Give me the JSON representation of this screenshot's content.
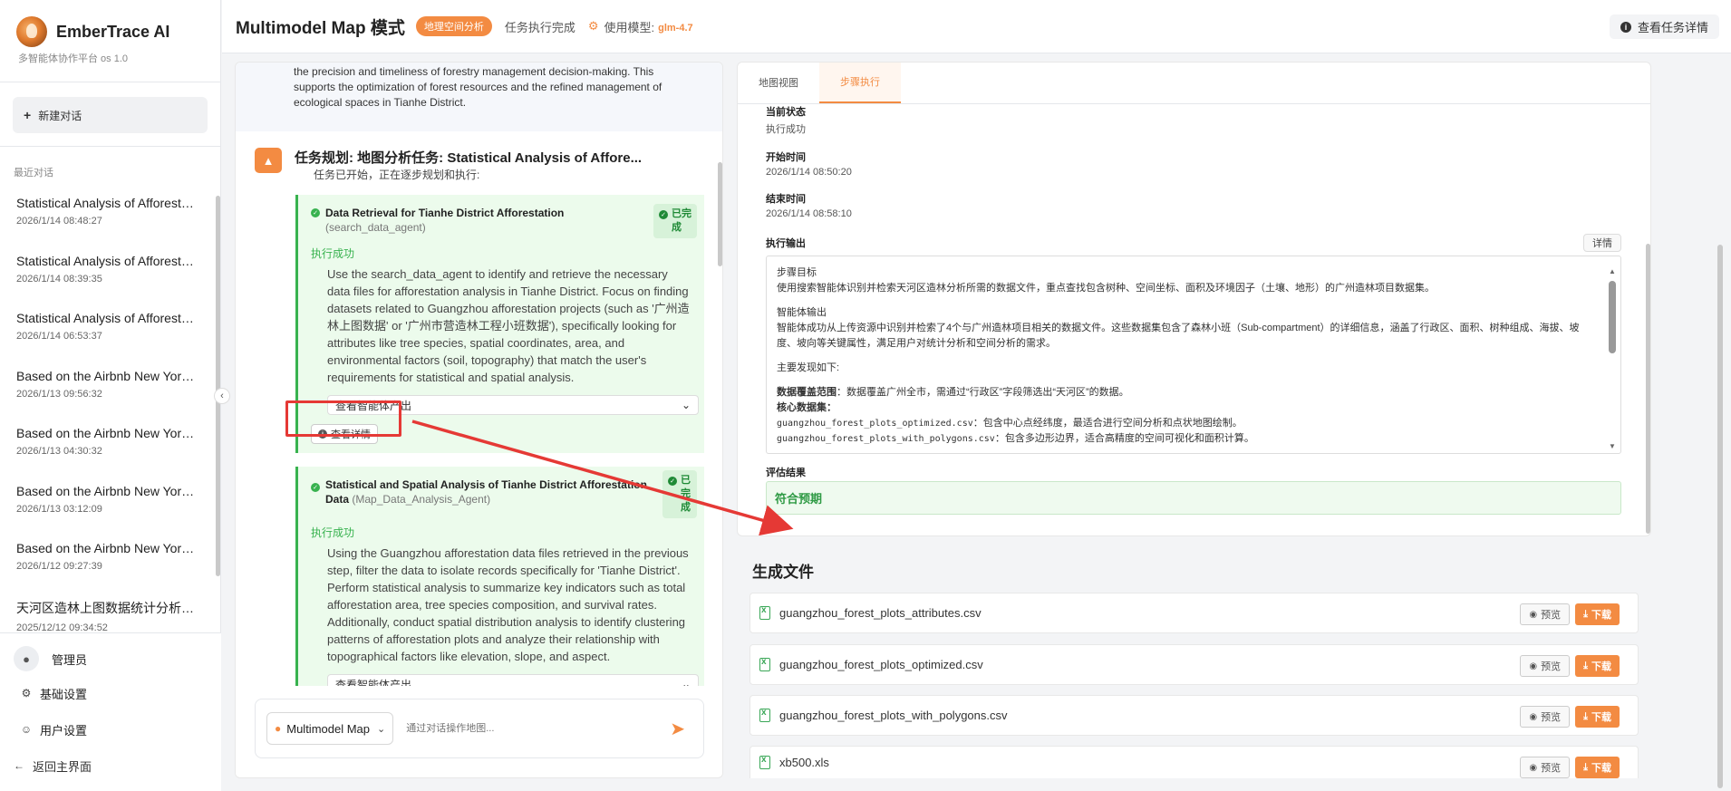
{
  "sidebar": {
    "brand_title": "EmberTrace AI",
    "brand_subtitle": "多智能体协作平台 os 1.0",
    "new_chat_label": "新建对话",
    "recent_label": "最近对话",
    "history": [
      {
        "title": "Statistical Analysis of Afforestation…",
        "date": "2026/1/14 08:48:27"
      },
      {
        "title": "Statistical Analysis of Afforestation…",
        "date": "2026/1/14 08:39:35"
      },
      {
        "title": "Statistical Analysis of Afforestation…",
        "date": "2026/1/14 06:53:37"
      },
      {
        "title": "Based on the Airbnb New York…",
        "date": "2026/1/13 09:56:32"
      },
      {
        "title": "Based on the Airbnb New York…",
        "date": "2026/1/13 04:30:32"
      },
      {
        "title": "Based on the Airbnb New York…",
        "date": "2026/1/13 03:12:09"
      },
      {
        "title": "Based on the Airbnb New York…",
        "date": "2026/1/12 09:27:39"
      },
      {
        "title": "天河区造林上图数据统计分析及…",
        "date": "2025/12/12 09:34:52"
      }
    ],
    "user_name": "管理员",
    "basic_settings": "基础设置",
    "user_settings": "用户设置",
    "back_home": "返回主界面"
  },
  "header": {
    "title": "Multimodel Map 模式",
    "badge": "地理空间分析",
    "status": "任务执行完成",
    "model_label": "使用模型:",
    "model_value": "glm-4.7",
    "detail_button": "查看任务详情"
  },
  "chat": {
    "top_message": "the precision and timeliness of forestry management decision-making. This supports the optimization of forest resources and the refined management of ecological spaces in Tianhe District.",
    "plan_title": "任务规划: 地图分析任务: Statistical Analysis of Affore...",
    "plan_subtitle": "任务已开始，正在逐步规划和执行:",
    "steps": [
      {
        "title": "Data Retrieval for Tianhe District Afforestation",
        "agent": "(search_data_agent)",
        "badge": "已完成",
        "status": "执行成功",
        "description": "Use the search_data_agent to identify and retrieve the necessary data files for afforestation analysis in Tianhe District. Focus on finding datasets related to Guangzhou afforestation projects (such as '广州造林上图数据' or '广州市营造林工程小班数据'), specifically looking for attributes like tree species, spatial coordinates, area, and environmental factors (soil, topography) that match the user's requirements for statistical and spatial analysis.",
        "agent_output_label": "查看智能体产出",
        "detail_label": "查看详情"
      },
      {
        "title": "Statistical and Spatial Analysis of Tianhe District Afforestation Data",
        "agent": "(Map_Data_Analysis_Agent)",
        "badge": "已完成",
        "status": "执行成功",
        "description": "Using the Guangzhou afforestation data files retrieved in the previous step, filter the data to isolate records specifically for 'Tianhe District'. Perform statistical analysis to summarize key indicators such as total afforestation area, tree species composition, and survival rates. Additionally, conduct spatial distribution analysis to identify clustering patterns of afforestation plots and analyze their relationship with topographical factors like elevation, slope, and aspect.",
        "agent_output_label": "查看智能体产出"
      }
    ],
    "model_select": "Multimodel Map",
    "input_placeholder": "通过对话操作地图..."
  },
  "right": {
    "tabs": [
      {
        "label": "地图视图",
        "active": false
      },
      {
        "label": "步骤执行",
        "active": true
      }
    ],
    "current_state_label": "当前状态",
    "current_state_value": "执行成功",
    "start_time_label": "开始时间",
    "start_time_value": "2026/1/14 08:50:20",
    "end_time_label": "结束时间",
    "end_time_value": "2026/1/14 08:58:10",
    "exec_output_label": "执行输出",
    "exec_output_detail_button": "详情",
    "output": {
      "goal_title": "步骤目标",
      "goal_text": "使用搜索智能体识别并检索天河区造林分析所需的数据文件，重点查找包含树种、空间坐标、面积及环境因子（土壤、地形）的广州造林项目数据集。",
      "agent_out_title": "智能体输出",
      "agent_out_text": "智能体成功从上传资源中识别并检索了4个与广州造林项目相关的数据文件。这些数据集包含了森林小班（Sub-compartment）的详细信息，涵盖了行政区、面积、树种组成、海拔、坡度、坡向等关键属性，满足用户对统计分析和空间分析的需求。",
      "findings_title": "主要发现如下:",
      "coverage_label": "数据覆盖范围",
      "coverage_text": "：数据覆盖广州全市，需通过“行政区”字段筛选出“天河区”的数据。",
      "core_label": "核心数据集",
      "core_suffix": "：",
      "file1_name": "guangzhou_forest_plots_optimized.csv",
      "file1_text": "：包含中心点经纬度，最适合进行空间分析和点状地图绘制。",
      "file2_name": "guangzhou_forest_plots_with_polygons.csv",
      "file2_text": "：包含多边形边界，适合高精度的空间可视化和面积计算。"
    },
    "eval_label": "评估结果",
    "eval_value": "符合预期",
    "files_title": "生成文件",
    "files": [
      {
        "name": "guangzhou_forest_plots_attributes.csv"
      },
      {
        "name": "guangzhou_forest_plots_optimized.csv"
      },
      {
        "name": "guangzhou_forest_plots_with_polygons.csv"
      },
      {
        "name": "xb500.xls"
      }
    ],
    "preview_label": "预览",
    "download_label": "下载"
  }
}
